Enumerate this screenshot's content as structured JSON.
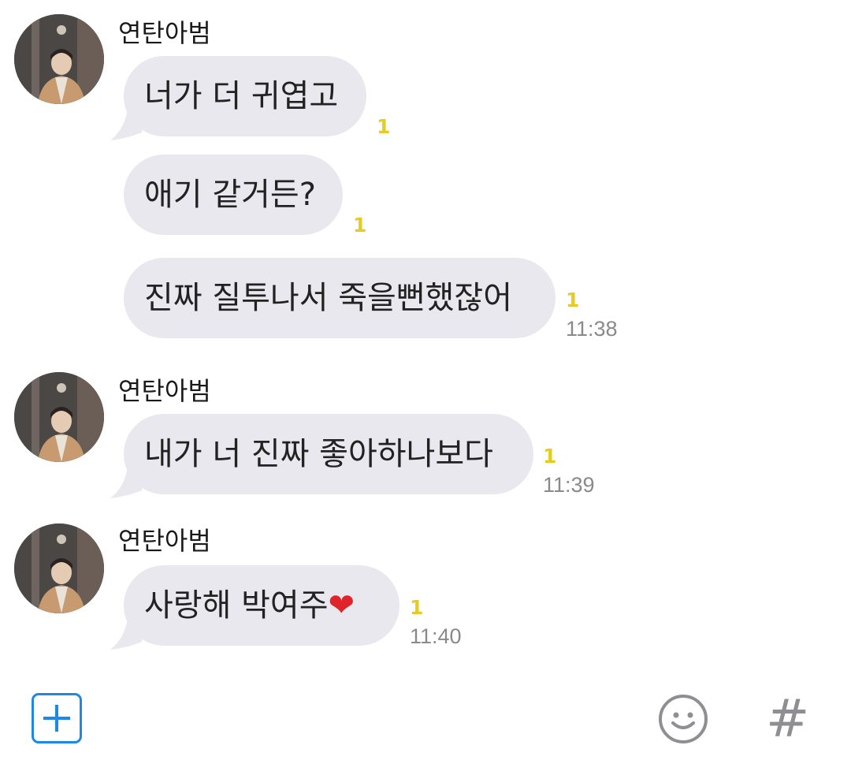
{
  "groups": [
    {
      "sender": "연탄아범",
      "messages": [
        {
          "text": "너가 더 귀엽고",
          "unread": "1",
          "time": ""
        },
        {
          "text": "애기 같거든?",
          "unread": "1",
          "time": ""
        },
        {
          "text": "진짜 질투나서 죽을뻔했잖어",
          "unread": "1",
          "time": "11:38"
        }
      ]
    },
    {
      "sender": "연탄아범",
      "messages": [
        {
          "text": "내가 너 진짜 좋아하나보다",
          "unread": "1",
          "time": "11:39"
        }
      ]
    },
    {
      "sender": "연탄아범",
      "messages": [
        {
          "text": "사랑해 박여주",
          "emoji": "❤",
          "unread": "1",
          "time": "11:40"
        }
      ]
    }
  ],
  "input_bar": {
    "plus_icon": "plus-square-icon",
    "emoji_icon": "smiley-icon",
    "hash_icon": "hash-icon",
    "hash_label": "#"
  },
  "colors": {
    "bubble": "#e8e8ee",
    "unread": "#e6cc20",
    "accent": "#1e88e5",
    "time": "#8a8a8a"
  }
}
